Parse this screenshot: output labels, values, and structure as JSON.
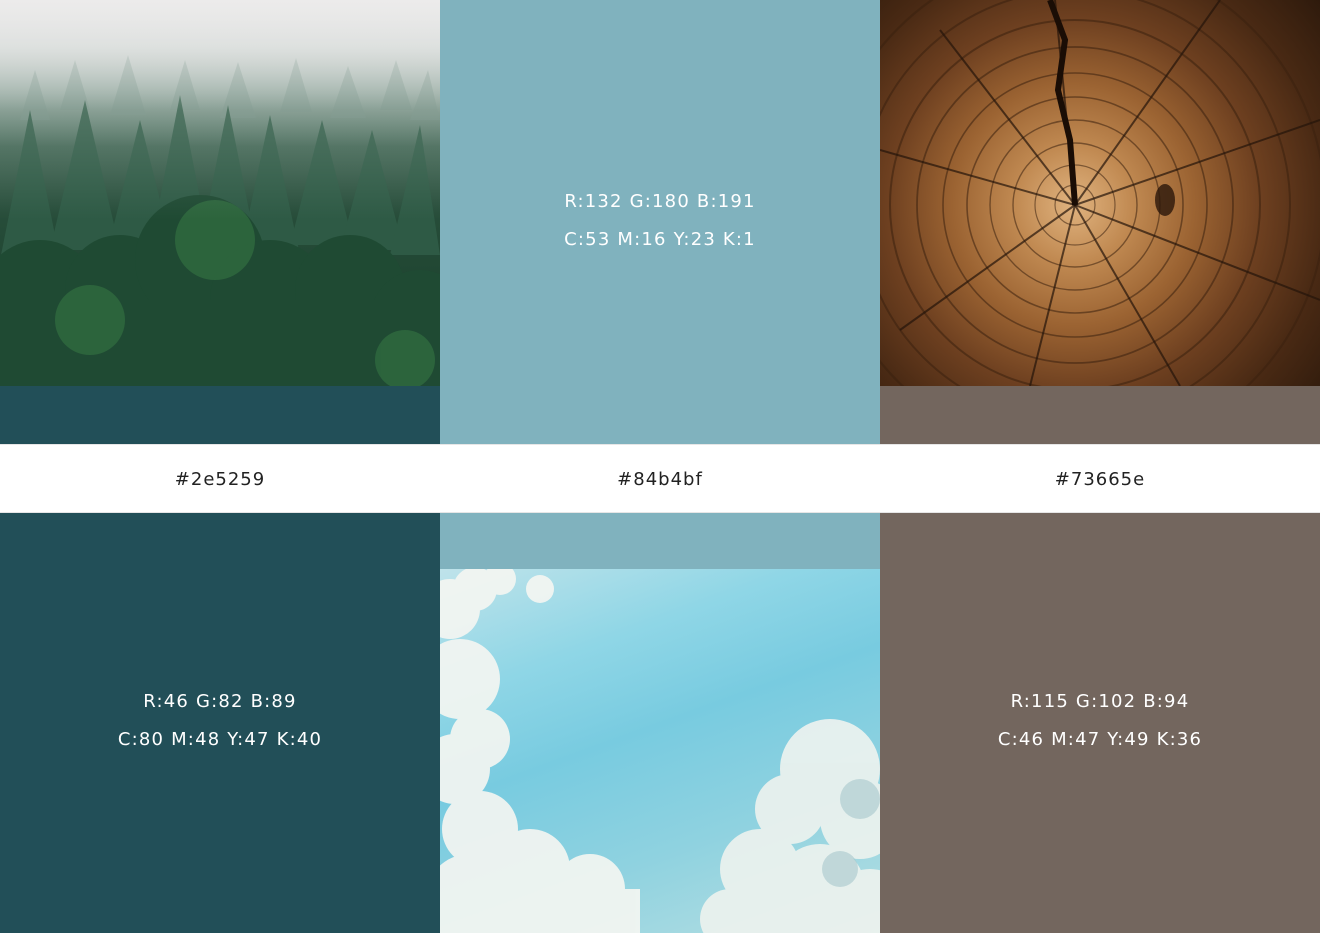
{
  "swatches": [
    {
      "hex": "#2e5259",
      "rgb": "R:46 G:82 B:89",
      "cmyk": "C:80 M:48 Y:47 K:40",
      "color": "#224f58",
      "photo": "forest-photo"
    },
    {
      "hex": "#84b4bf",
      "rgb": "R:132 G:180 B:191",
      "cmyk": "C:53 M:16 Y:23 K:1",
      "color": "#80b2be",
      "photo": "sky-photo"
    },
    {
      "hex": "#73665e",
      "rgb": "R:115 G:102 B:94",
      "cmyk": "C:46 M:47 Y:49 K:36",
      "color": "#73665e",
      "photo": "wood-photo"
    }
  ]
}
